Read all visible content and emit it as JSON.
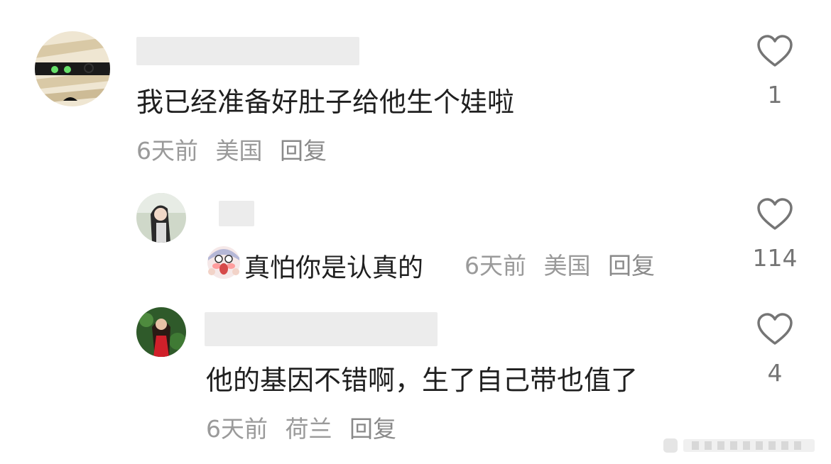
{
  "comments": [
    {
      "text": "我已经准备好肚子给他生个娃啦",
      "time": "6天前",
      "location": "美国",
      "reply_label": "回复",
      "like_count": "1"
    }
  ],
  "replies": [
    {
      "emoji_icon": "screaming-in-fear-emoji",
      "text": "真怕你是认真的",
      "time": "6天前",
      "location": "美国",
      "reply_label": "回复",
      "like_count": "114"
    },
    {
      "text": "他的基因不错啊，生了自己带也值了",
      "time": "6天前",
      "location": "荷兰",
      "reply_label": "回复",
      "like_count": "4"
    }
  ],
  "colors": {
    "text": "#1f1f1f",
    "meta": "#9a9a9a",
    "like_stroke": "#757575"
  }
}
